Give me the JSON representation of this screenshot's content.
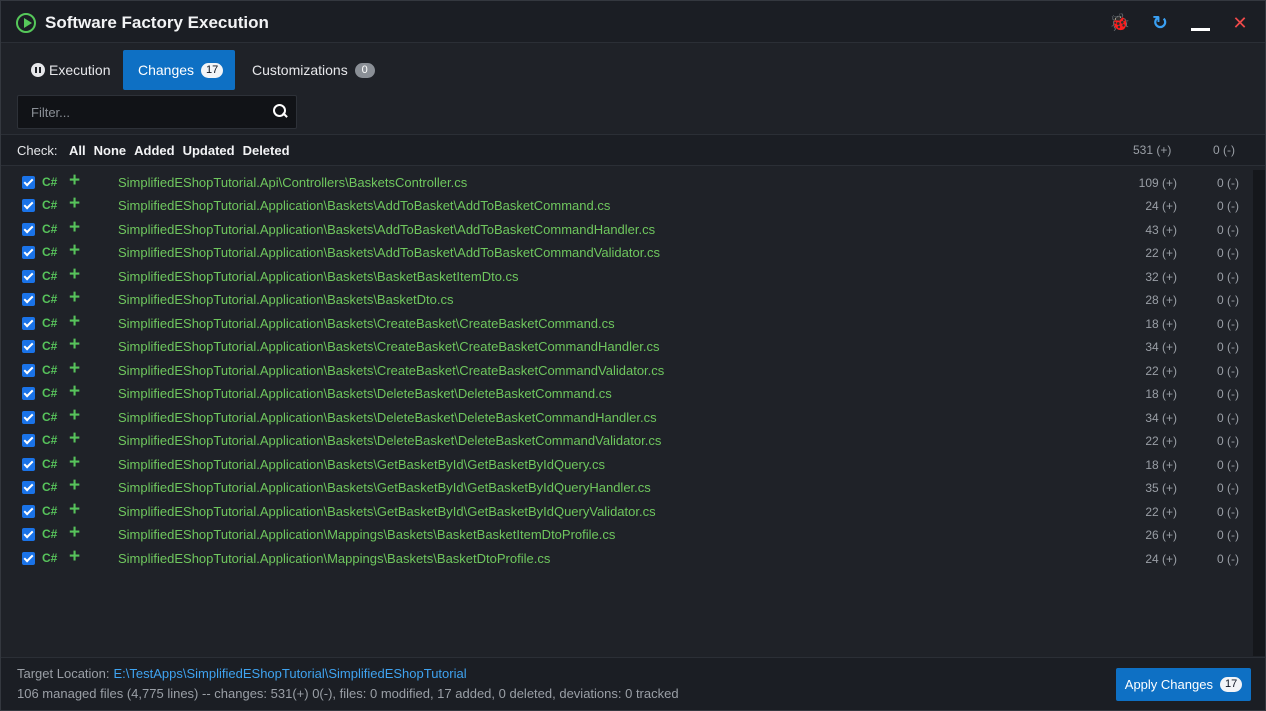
{
  "window": {
    "title": "Software Factory Execution"
  },
  "tabs": [
    {
      "label": "Execution",
      "badge": ""
    },
    {
      "label": "Changes",
      "badge": "17"
    },
    {
      "label": "Customizations",
      "badge": "0"
    }
  ],
  "filter": {
    "placeholder": "Filter...",
    "value": ""
  },
  "check": {
    "label": "Check:",
    "options": [
      "All",
      "None",
      "Added",
      "Updated",
      "Deleted"
    ],
    "total_added": "531 (+)",
    "total_deleted": "0 (-)"
  },
  "files": [
    {
      "lang": "C#",
      "path": "SimplifiedEShopTutorial.Api\\Controllers\\BasketsController.cs",
      "added": "109 (+)",
      "deleted": "0 (-)"
    },
    {
      "lang": "C#",
      "path": "SimplifiedEShopTutorial.Application\\Baskets\\AddToBasket\\AddToBasketCommand.cs",
      "added": "24 (+)",
      "deleted": "0 (-)"
    },
    {
      "lang": "C#",
      "path": "SimplifiedEShopTutorial.Application\\Baskets\\AddToBasket\\AddToBasketCommandHandler.cs",
      "added": "43 (+)",
      "deleted": "0 (-)"
    },
    {
      "lang": "C#",
      "path": "SimplifiedEShopTutorial.Application\\Baskets\\AddToBasket\\AddToBasketCommandValidator.cs",
      "added": "22 (+)",
      "deleted": "0 (-)"
    },
    {
      "lang": "C#",
      "path": "SimplifiedEShopTutorial.Application\\Baskets\\BasketBasketItemDto.cs",
      "added": "32 (+)",
      "deleted": "0 (-)"
    },
    {
      "lang": "C#",
      "path": "SimplifiedEShopTutorial.Application\\Baskets\\BasketDto.cs",
      "added": "28 (+)",
      "deleted": "0 (-)"
    },
    {
      "lang": "C#",
      "path": "SimplifiedEShopTutorial.Application\\Baskets\\CreateBasket\\CreateBasketCommand.cs",
      "added": "18 (+)",
      "deleted": "0 (-)"
    },
    {
      "lang": "C#",
      "path": "SimplifiedEShopTutorial.Application\\Baskets\\CreateBasket\\CreateBasketCommandHandler.cs",
      "added": "34 (+)",
      "deleted": "0 (-)"
    },
    {
      "lang": "C#",
      "path": "SimplifiedEShopTutorial.Application\\Baskets\\CreateBasket\\CreateBasketCommandValidator.cs",
      "added": "22 (+)",
      "deleted": "0 (-)"
    },
    {
      "lang": "C#",
      "path": "SimplifiedEShopTutorial.Application\\Baskets\\DeleteBasket\\DeleteBasketCommand.cs",
      "added": "18 (+)",
      "deleted": "0 (-)"
    },
    {
      "lang": "C#",
      "path": "SimplifiedEShopTutorial.Application\\Baskets\\DeleteBasket\\DeleteBasketCommandHandler.cs",
      "added": "34 (+)",
      "deleted": "0 (-)"
    },
    {
      "lang": "C#",
      "path": "SimplifiedEShopTutorial.Application\\Baskets\\DeleteBasket\\DeleteBasketCommandValidator.cs",
      "added": "22 (+)",
      "deleted": "0 (-)"
    },
    {
      "lang": "C#",
      "path": "SimplifiedEShopTutorial.Application\\Baskets\\GetBasketById\\GetBasketByIdQuery.cs",
      "added": "18 (+)",
      "deleted": "0 (-)"
    },
    {
      "lang": "C#",
      "path": "SimplifiedEShopTutorial.Application\\Baskets\\GetBasketById\\GetBasketByIdQueryHandler.cs",
      "added": "35 (+)",
      "deleted": "0 (-)"
    },
    {
      "lang": "C#",
      "path": "SimplifiedEShopTutorial.Application\\Baskets\\GetBasketById\\GetBasketByIdQueryValidator.cs",
      "added": "22 (+)",
      "deleted": "0 (-)"
    },
    {
      "lang": "C#",
      "path": "SimplifiedEShopTutorial.Application\\Mappings\\Baskets\\BasketBasketItemDtoProfile.cs",
      "added": "26 (+)",
      "deleted": "0 (-)"
    },
    {
      "lang": "C#",
      "path": "SimplifiedEShopTutorial.Application\\Mappings\\Baskets\\BasketDtoProfile.cs",
      "added": "24 (+)",
      "deleted": "0 (-)"
    }
  ],
  "footer": {
    "target_label": "Target Location:",
    "target_path": "E:\\TestApps\\SimplifiedEShopTutorial\\SimplifiedEShopTutorial",
    "stats": "106 managed files (4,775 lines) -- changes: 531(+) 0(-), files: 0 modified, 17 added, 0 deleted, deviations: 0 tracked",
    "apply_label": "Apply Changes",
    "apply_badge": "17"
  },
  "colors": {
    "accent": "#0e70c4",
    "added_green": "#57c35b",
    "link_blue": "#3fa3f0",
    "close_red": "#f04a4a"
  },
  "icons": [
    "app-play-icon",
    "bug-icon",
    "refresh-icon",
    "minimize-icon",
    "close-icon",
    "pause-icon",
    "search-icon",
    "checkbox-icon",
    "plus-icon"
  ]
}
